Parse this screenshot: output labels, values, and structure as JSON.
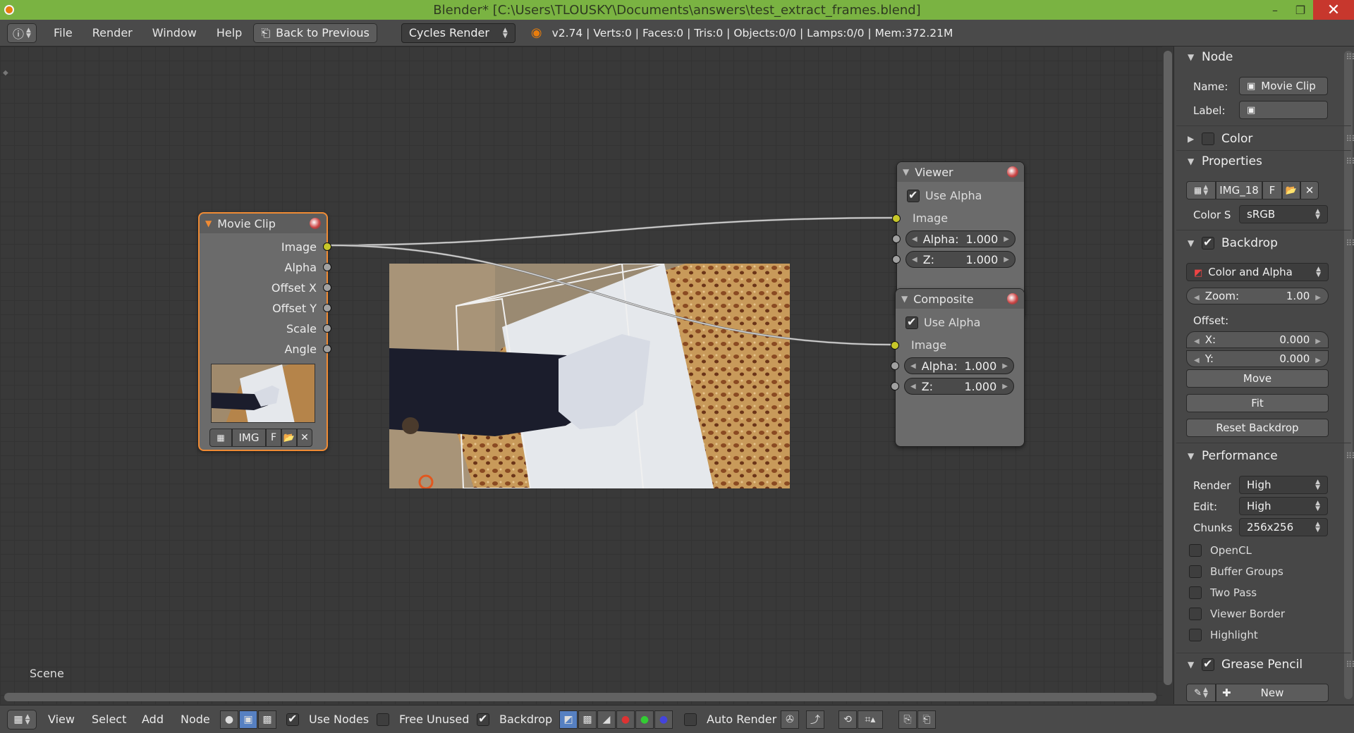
{
  "titlebar": {
    "title": "Blender* [C:\\Users\\TLOUSKY\\Documents\\answers\\test_extract_frames.blend]",
    "minimize": "–",
    "maximize": "❐",
    "close": "✕"
  },
  "menubar": {
    "items": [
      "File",
      "Render",
      "Window",
      "Help"
    ],
    "back_button": "Back to Previous",
    "engine": "Cycles Render",
    "stats": "v2.74 | Verts:0 | Faces:0 | Tris:0 | Objects:0/0 | Lamps:0/0 | Mem:372.21M"
  },
  "editor": {
    "scene_label": "Scene"
  },
  "nodes": {
    "movieclip": {
      "title": "Movie Clip",
      "outputs": [
        "Image",
        "Alpha",
        "Offset X",
        "Offset Y",
        "Scale",
        "Angle"
      ],
      "clip_name": "IMG",
      "fake_user": "F"
    },
    "viewer": {
      "title": "Viewer",
      "use_alpha": "Use Alpha",
      "input": "Image",
      "alpha_label": "Alpha:",
      "alpha_value": "1.000",
      "z_label": "Z:",
      "z_value": "1.000"
    },
    "composite": {
      "title": "Composite",
      "use_alpha": "Use Alpha",
      "input": "Image",
      "alpha_label": "Alpha:",
      "alpha_value": "1.000",
      "z_label": "Z:",
      "z_value": "1.000"
    }
  },
  "sidebar": {
    "node_panel": {
      "title": "Node",
      "name_label": "Name:",
      "name_value": "Movie Clip",
      "label_label": "Label:"
    },
    "color_panel": {
      "title": "Color"
    },
    "properties_panel": {
      "title": "Properties",
      "clip": "IMG_18",
      "fake_user": "F",
      "colorspace_label": "Color S",
      "colorspace_value": "sRGB"
    },
    "backdrop_panel": {
      "title": "Backdrop",
      "mode": "Color and Alpha",
      "zoom_label": "Zoom:",
      "zoom_value": "1.00",
      "offset_label": "Offset:",
      "x_label": "X:",
      "x_value": "0.000",
      "y_label": "Y:",
      "y_value": "0.000",
      "move": "Move",
      "fit": "Fit",
      "reset": "Reset Backdrop"
    },
    "performance_panel": {
      "title": "Performance",
      "render_label": "Render",
      "render_value": "High",
      "edit_label": "Edit:",
      "edit_value": "High",
      "chunks_label": "Chunks",
      "chunks_value": "256x256",
      "options": [
        "OpenCL",
        "Buffer Groups",
        "Two Pass",
        "Viewer Border",
        "Highlight"
      ]
    },
    "grease_panel": {
      "title": "Grease Pencil",
      "new": "New"
    }
  },
  "bottombar": {
    "menus": [
      "View",
      "Select",
      "Add",
      "Node"
    ],
    "use_nodes": "Use Nodes",
    "free_unused": "Free Unused",
    "backdrop": "Backdrop",
    "auto_render": "Auto Render"
  },
  "colors": {
    "title_green": "#7ab342",
    "node_active": "#f08b34",
    "socket_yellow": "#c7c729"
  }
}
